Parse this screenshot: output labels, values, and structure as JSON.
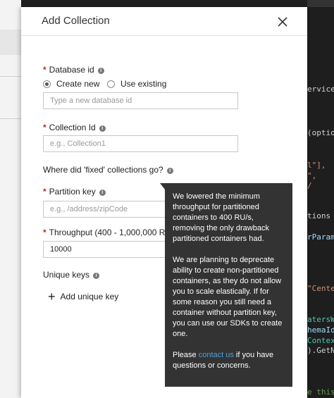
{
  "dialog": {
    "title": "Add Collection",
    "close_label": "Close"
  },
  "fields": {
    "database_id": {
      "required_mark": "*",
      "label": "Database id",
      "radio_create": "Create new",
      "radio_existing": "Use existing",
      "selected": "Create new",
      "placeholder": "Type a new database id"
    },
    "collection_id": {
      "required_mark": "*",
      "label": "Collection Id",
      "placeholder": "e.g., Collection1"
    },
    "fixed_question": "Where did 'fixed' collections go?",
    "partition_key": {
      "required_mark": "*",
      "label": "Partition key",
      "placeholder": "e.g., /address/zipCode"
    },
    "throughput": {
      "required_mark": "*",
      "label": "Throughput (400 - 1,000,000 RU/s)",
      "value": "10000"
    },
    "unique_keys": {
      "label": "Unique keys",
      "add_label": "Add unique key"
    }
  },
  "tooltip": {
    "paragraph1": "We lowered the minimum throughput for partitioned containers to 400 RU/s, removing the only drawback partitioned containers had.",
    "paragraph2": "We are planning to deprecate ability to create non-partitioned containers, as they do not allow you to scale elastically. If for some reason you still need a container without partition key, you can use our SDKs to create one.",
    "please": "Please ",
    "link_text": "contact us",
    "after_link": " if you have questions or concerns."
  },
  "background_code": [
    "ervice.S",
    "(optio",
    "l\"],",
    "\",",
    "/",
    "tions",
    "rParam",
    "\"Cente",
    "atersW",
    "hemaId",
    "Contex",
    ").GetN",
    "e this"
  ],
  "colors": {
    "tooltip_bg": "#333333",
    "link": "#4aa3df",
    "required": "#c1272d"
  }
}
